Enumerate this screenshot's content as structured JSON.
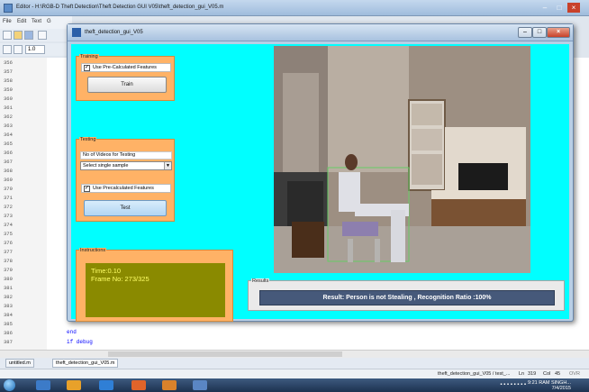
{
  "editor": {
    "title": "Editor - H:\\RGB-D Theft Detection\\Theft Detection GUI V05\\theft_detection_gui_V05.m",
    "menu": [
      "File",
      "Edit",
      "Text",
      "G"
    ],
    "zoom": "1.0",
    "line_numbers": [
      "356",
      "357",
      "358",
      "359",
      "360",
      "361",
      "362",
      "363",
      "364",
      "365",
      "366",
      "367",
      "368",
      "369",
      "370",
      "371",
      "372",
      "373",
      "374",
      "375",
      "376",
      "377",
      "378",
      "379",
      "380",
      "381",
      "382",
      "383",
      "384",
      "385",
      "386",
      "387"
    ],
    "code_lines": [
      "end",
      "if debug"
    ],
    "doc_tabs": [
      "untitled.m",
      "theft_detection_gui_V05.m"
    ],
    "status": {
      "function": "theft_detection_gui_V05 / test_...",
      "ln_label": "Ln",
      "ln": "319",
      "col_label": "Col",
      "col": "45",
      "mode": "OVR"
    }
  },
  "taskbar": {
    "time": "9:21 RAM SINGH...",
    "date": "7/4/2015"
  },
  "gui": {
    "window_title": "theft_detection_gui_V05",
    "training": {
      "title": "Training",
      "use_precalc_label": "Use Pre-Calculated Features",
      "use_precalc_checked": true,
      "train_button": "Train"
    },
    "testing": {
      "title": "Testing",
      "num_videos_label": "No of Videos for Testing",
      "sample_select": "Select single sample",
      "use_precalc_label": "Use Precalculated Features",
      "use_precalc_checked": true,
      "test_button": "Test"
    },
    "instructions": {
      "title": "Instructions",
      "time_line": "Time:0.10",
      "frame_line": "Frame No: 273/325"
    },
    "results": {
      "title": "Results",
      "text": "Result: Person is not Stealing , Recognition Ratio :100%"
    },
    "colors": {
      "canvas": "#00ffff",
      "panel": "#ffb266",
      "instructions_bg": "#8a8a00",
      "instructions_text": "#ffff66",
      "result_bar": "#46597a"
    }
  }
}
